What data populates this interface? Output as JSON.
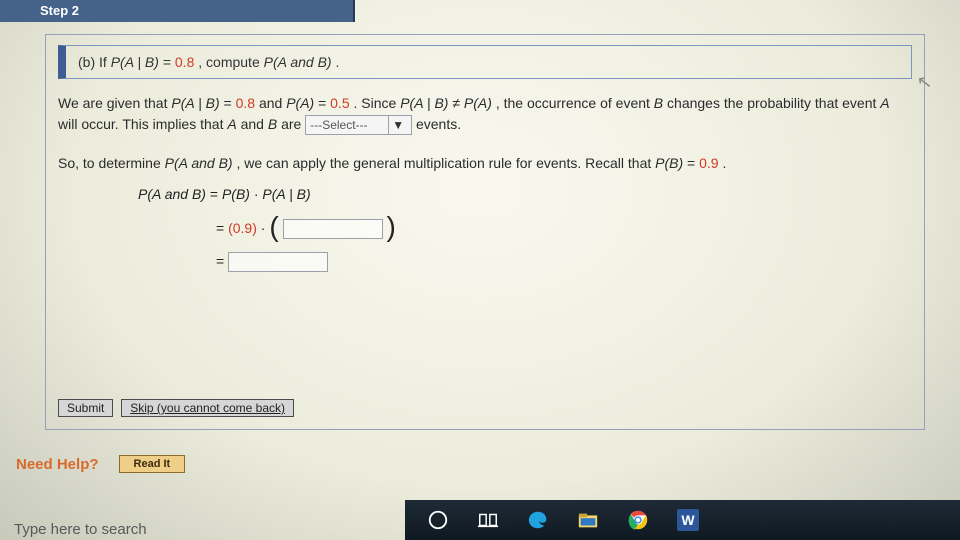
{
  "step_tab": "Step 2",
  "question": {
    "part": "(b)",
    "prefix": "If ",
    "expr1_lhs": "P(A | B)",
    "eq": " = ",
    "val08": "0.8",
    "suffix": ", compute ",
    "expr2": "P(A and B)",
    "period": "."
  },
  "para1": {
    "t1": "We are given that ",
    "e1": "P(A | B)",
    "t2": " = ",
    "v1": "0.8",
    "t3": " and ",
    "e2": "P(A)",
    "t4": " = ",
    "v2": "0.5",
    "t5": ". Since ",
    "e3": "P(A | B)",
    "ne": " ≠ ",
    "e4": "P(A)",
    "t6": ", the occurrence of event ",
    "B": "B",
    "t7": " changes the probability that event ",
    "A": "A",
    "t8": " will occur. This implies that ",
    "A2": "A",
    "t9": " and ",
    "B2": "B",
    "t10": " are ",
    "select_placeholder": "---Select---",
    "t11": " events."
  },
  "para2": {
    "t1": "So, to determine ",
    "e1": "P(A and B)",
    "t2": ", we can apply the general multiplication rule for events. Recall that ",
    "e2": "P(B)",
    "t3": " = ",
    "v1": "0.9",
    "t4": "."
  },
  "math": {
    "line1_lhs": "P(A and B)",
    "eq": "  =  ",
    "line1_rhs_a": "P(B)",
    "dot": " · ",
    "line1_rhs_b": "P(A | B)",
    "line2_val": "(0.9)",
    "line2_dot": " · "
  },
  "buttons": {
    "submit": "Submit",
    "skip": "Skip (you cannot come back)"
  },
  "need_help": {
    "label": "Need Help?",
    "read_it": "Read It"
  },
  "search_placeholder": "Type here to search",
  "taskbar_icons": [
    "cortana",
    "taskview",
    "edge",
    "file-explorer",
    "chrome",
    "word"
  ]
}
